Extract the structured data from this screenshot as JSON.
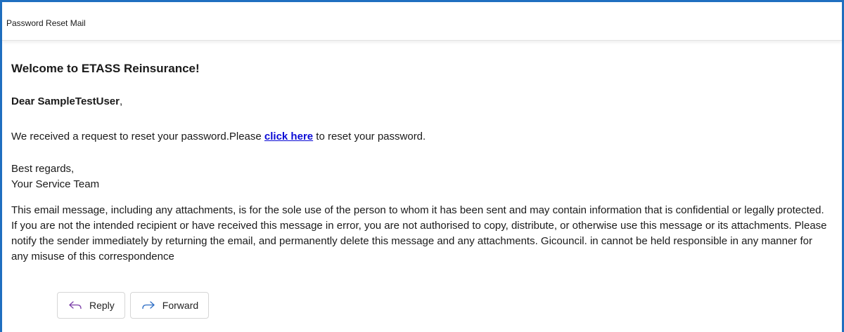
{
  "header": {
    "title": "Password Reset Mail"
  },
  "email": {
    "heading": "Welcome to ETASS Reinsurance!",
    "greeting_prefix": "Dear ",
    "greeting_name": "SampleTestUser",
    "greeting_suffix": ",",
    "request_before": "We received a request to reset your password.Please ",
    "request_link": "click here",
    "request_after": " to reset your password.",
    "regards_line1": "Best regards,",
    "regards_line2": "Your Service Team",
    "disclaimer": "This email message, including any attachments, is for the sole use of the person to whom it has been sent and may contain information that is confidential or legally protected. If you are not the intended recipient or have received this message in error, you are not authorised to copy, distribute, or otherwise use this message or its attachments. Please notify the sender immediately by returning the email, and permanently delete this message and any attachments. Gicouncil. in cannot be held responsible in any manner for any misuse of this correspondence"
  },
  "actions": {
    "reply_label": "Reply",
    "reply_icon": "reply-icon",
    "forward_label": "Forward",
    "forward_icon": "forward-icon",
    "reply_icon_color": "#7b3fa8",
    "forward_icon_color": "#2b6cc4"
  },
  "colors": {
    "frame_border": "#1f6fc0",
    "link": "#0b0bd6"
  }
}
